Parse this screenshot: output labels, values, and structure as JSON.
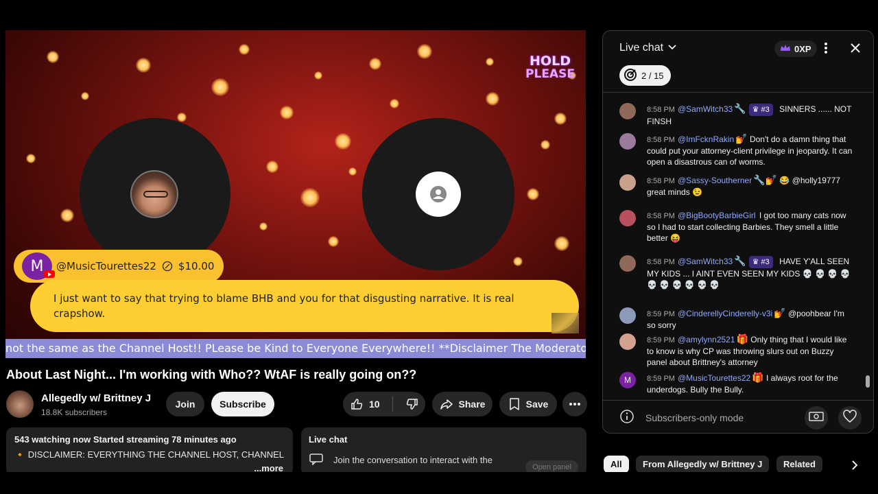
{
  "video": {
    "hold_line1": "HOLD",
    "hold_line2": "PLEASE",
    "superchat": {
      "avatar_letter": "M",
      "user": "@MusicTourettes22",
      "amount": "$10.00",
      "message": "I just want to say that trying to blame BHB and you for that disgusting narrative. It is real crapshow."
    },
    "ticker": "not the same as the Channel Host!! PLease be Kind to Everyone Everywhere!! **Disclaimer The Moderators"
  },
  "meta": {
    "title": "About Last Night... I'm working with Who?? WtAF is really going on??",
    "channel_name": "Allegedly w/ Brittney J",
    "subscribers": "18.8K subscribers",
    "join_label": "Join",
    "subscribe_label": "Subscribe",
    "like_count": "10",
    "share_label": "Share",
    "save_label": "Save"
  },
  "description": {
    "stats": "543 watching now  Started streaming 78 minutes ago",
    "text": "🔸 DISCLAIMER: EVERYTHING THE CHANNEL HOST, CHANNEL GUEST & CHATTERS SPEAK IS OPINION BASED AND SH",
    "more": "...more"
  },
  "live_chat_box": {
    "heading": "Live chat",
    "prompt": "Join the conversation to interact with the",
    "open_panel": "Open panel"
  },
  "chat": {
    "title": "Live chat",
    "xp": "0XP",
    "goal": "2 / 15",
    "footer": "Subscribers-only mode",
    "messages": [
      {
        "time": "8:58 PM",
        "author": "@SamWitch33",
        "badge": "🔧",
        "rank": "#3",
        "text": "SINNERS ...... NOT FINSH",
        "color": "#8f6a5a"
      },
      {
        "time": "8:58 PM",
        "author": "@ImFcknRakin",
        "badge": "💅",
        "rank": "",
        "text": "Don't do a damn thing that could put your attorney-client privilege in jeopardy. It can open a disastrous can of worms.",
        "color": "#9a7b9e"
      },
      {
        "time": "8:58 PM",
        "author": "@Sassy-Southerner",
        "badge": "🔧💅",
        "rank": "",
        "text": "😂 @holly19777 great minds 😉",
        "color": "#c9a08a"
      },
      {
        "time": "8:58 PM",
        "author": "@BigBootyBarbieGirl",
        "badge": "",
        "rank": "",
        "text": "I got too many cats now so I had to start collecting Barbies. They smell a little better 😝",
        "color": "#b8505e"
      },
      {
        "time": "8:58 PM",
        "author": "@SamWitch33",
        "badge": "🔧",
        "rank": "#3",
        "text": "HAVE Y'ALL SEEN MY KIDS ... I AINT EVEN SEEN MY KIDS 💀 💀 💀 💀 💀 💀 💀 💀 💀 💀",
        "color": "#8f6a5a"
      },
      {
        "time": "8:59 PM",
        "author": "@CinderellyCinderelly-v3i",
        "badge": "💅",
        "rank": "",
        "text": "@poohbear I'm so sorry",
        "color": "#8a9ab8"
      },
      {
        "time": "8:59 PM",
        "author": "@amylynn2521",
        "badge": "🎁",
        "rank": "",
        "text": "Only thing that I would like to know is why CP was throwing slurs out on Buzzy panel about Brittney's attorney",
        "color": "#d4a090"
      },
      {
        "time": "8:59 PM",
        "author": "@MusicTourettes22",
        "badge": "🎁",
        "rank": "",
        "text": "I always root for the underdogs. Bully the Bully.",
        "color": "#7b22a3",
        "letter": "M"
      }
    ]
  },
  "chips": [
    "All",
    "From Allegedly w/ Brittney J",
    "Related"
  ]
}
